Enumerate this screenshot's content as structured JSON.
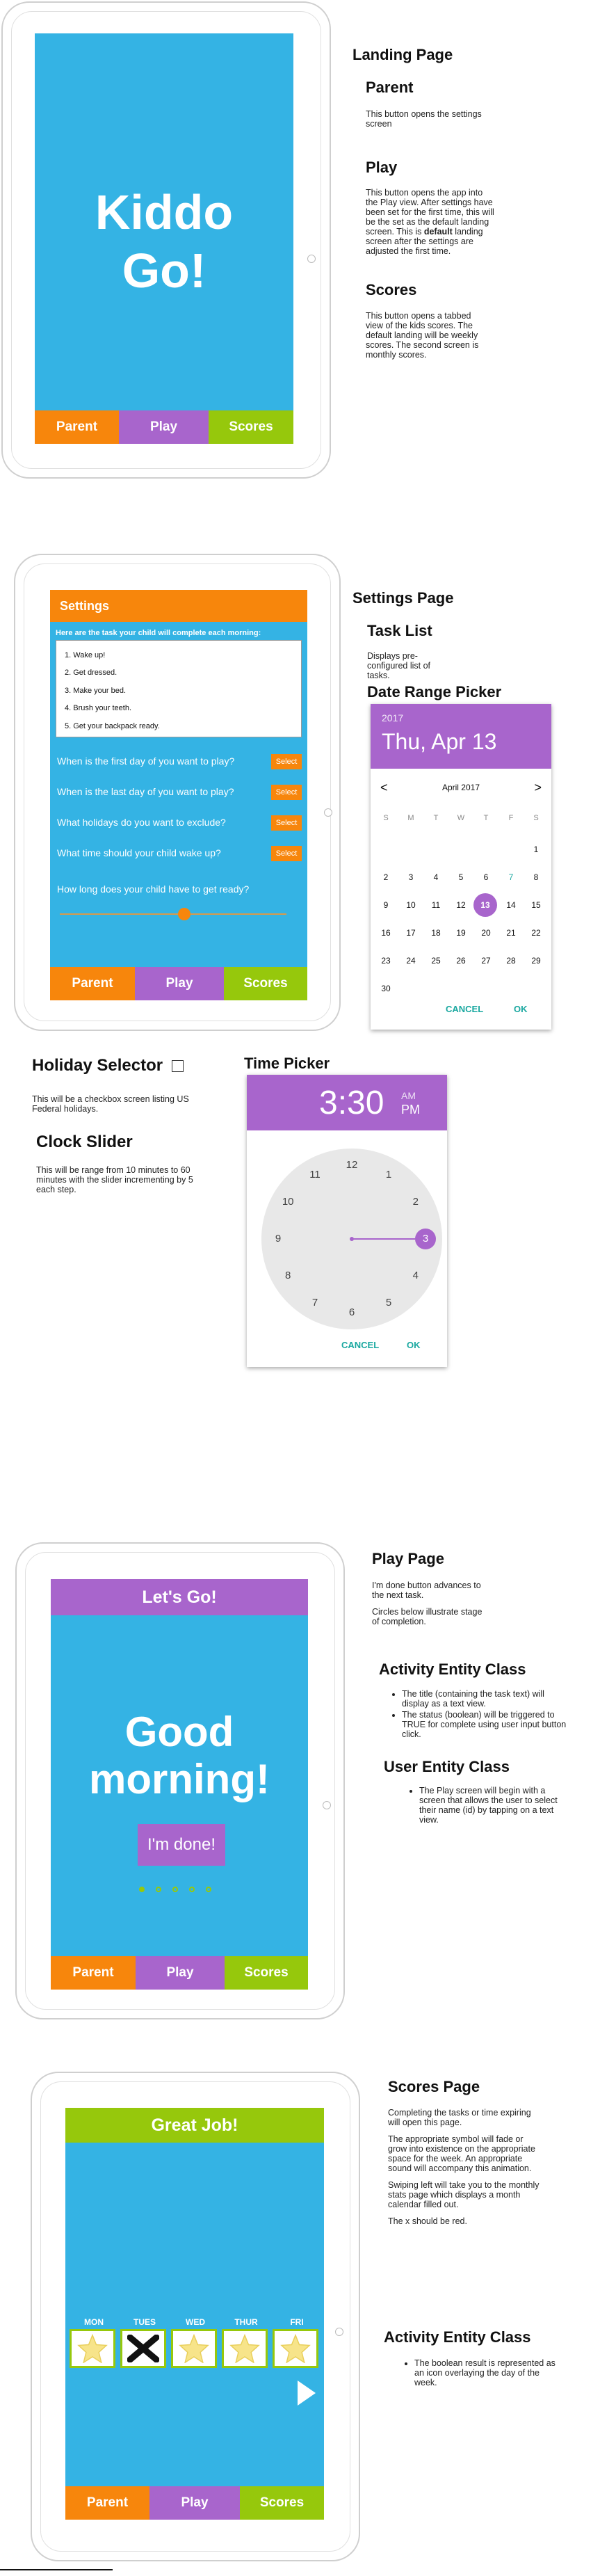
{
  "nav": {
    "parent": "Parent",
    "play": "Play",
    "scores": "Scores"
  },
  "landing": {
    "logo_line1": "Kiddo",
    "logo_line2": "Go!",
    "heading": "Landing Page",
    "parent_title": "Parent",
    "parent_desc": "This button opens the settings screen",
    "play_title": "Play",
    "play_desc_1": "This button opens the app into the Play view. After settings have been set for the first time, this will be the set as the default landing screen.  This is ",
    "play_desc_bold": "default",
    "play_desc_2": " landing screen after the settings are adjusted the first time.",
    "scores_title": "Scores",
    "scores_desc": "This button opens a tabbed view of the kids scores. The default landing will be weekly scores. The second screen is monthly scores."
  },
  "settings": {
    "header": "Settings",
    "tasks_prompt": "Here are the task your child will complete each morning:",
    "tasks": [
      "1. Wake up!",
      "2. Get dressed.",
      "3. Make your bed.",
      "4. Brush your teeth.",
      "5. Get your backpack ready."
    ],
    "q_first_day": "When is the first day of you want to play?",
    "q_last_day": "When is the last day of you want to play?",
    "q_holidays": "What holidays do you want to exclude?",
    "q_wake": "What time should your child wake up?",
    "q_ready": "How long does your child have to get ready?",
    "select_label": "Select",
    "slider_value": 0.55,
    "heading": "Settings Page",
    "task_list_title": "Task List",
    "task_list_desc": "Displays pre-configured list of tasks.",
    "date_picker_title": "Date Range Picker"
  },
  "calendar": {
    "year": "2017",
    "date": "Thu, Apr 13",
    "month": "April 2017",
    "prev": "<",
    "next": ">",
    "weekdays": [
      "S",
      "M",
      "T",
      "W",
      "T",
      "F",
      "S"
    ],
    "selected_day": 13,
    "cancel": "CANCEL",
    "ok": "OK"
  },
  "holiday": {
    "title": "Holiday Selector",
    "desc": "This will be a checkbox screen listing US Federal holidays."
  },
  "slider_note": {
    "title": "Clock Slider",
    "desc": "This will be range from 10 minutes to 60 minutes with the slider incrementing by 5 each step."
  },
  "timepicker": {
    "title": "Time Picker",
    "time": "3:30",
    "am": "AM",
    "pm": "PM",
    "numbers": [
      "12",
      "1",
      "2",
      "3",
      "4",
      "5",
      "6",
      "7",
      "8",
      "9",
      "10",
      "11"
    ],
    "cancel": "CANCEL",
    "ok": "OK"
  },
  "play": {
    "header": "Let's Go!",
    "greeting_1": "Good",
    "greeting_2": "morning!",
    "done": "I'm done!",
    "heading": "Play Page",
    "desc_1": "I'm done button advances to the next task.",
    "desc_2": "Circles below illustrate stage of completion.",
    "entity_title": "Activity Entity Class",
    "entity_items": [
      "The title (containing the task text) will display as a text view.",
      "The status (boolean) will be triggered to TRUE for complete using user input button click."
    ],
    "user_title": "User Entity Class",
    "user_items": [
      "The Play screen will begin with a screen that allows the user to select their name (id) by tapping on a text view."
    ],
    "progress_total": 5,
    "progress_done": 1
  },
  "scores": {
    "header": "Great Job!",
    "days": [
      "MON",
      "TUES",
      "WED",
      "THUR",
      "FRI"
    ],
    "results": [
      true,
      false,
      true,
      true,
      true
    ],
    "heading": "Scores Page",
    "desc_1": "Completing the tasks or time expiring will open this page.",
    "desc_2": "The appropriate symbol will fade or grow into existence on the appropriate space for the week. An appropriate sound will accompany this animation.",
    "desc_3": "Swiping left will take you to the monthly stats page which displays a month calendar filled out.",
    "desc_4": "The x should be red.",
    "entity_title": "Activity Entity Class",
    "entity_items": [
      "The boolean result is represented as an icon overlaying the day of the week."
    ]
  },
  "colors": {
    "blue": "#34b3e4",
    "orange": "#f7860c",
    "purple": "#a865cc",
    "green": "#96c80c"
  }
}
